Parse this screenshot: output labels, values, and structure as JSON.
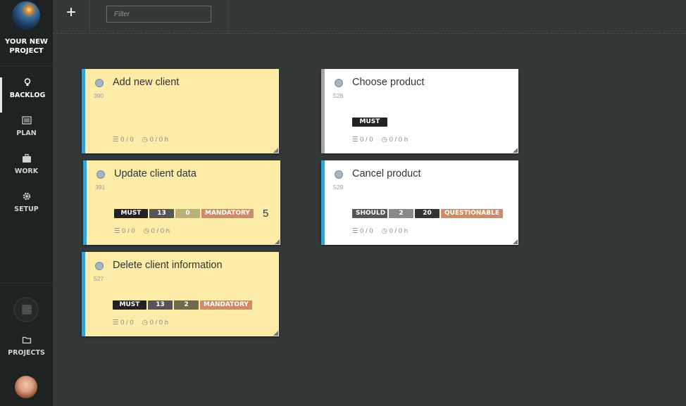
{
  "sidebar": {
    "project_name_line1": "YOUR NEW",
    "project_name_line2": "PROJECT",
    "nav": [
      {
        "label": "BACKLOG",
        "icon": "lightbulb-icon",
        "active": true
      },
      {
        "label": "PLAN",
        "icon": "list-icon",
        "active": false
      },
      {
        "label": "WORK",
        "icon": "briefcase-icon",
        "active": false
      },
      {
        "label": "SETUP",
        "icon": "gear-icon",
        "active": false
      }
    ],
    "projects_label": "PROJECTS"
  },
  "topbar": {
    "add_label": "+",
    "filter_placeholder": "Filter"
  },
  "colors": {
    "accent": "#3aa0d0",
    "card_yellow": "#fdeba8",
    "tag_dark": "#222222",
    "tag_mid": "#555555",
    "tag_light": "#b8b27a",
    "tag_orange": "#d08a65"
  },
  "cards": [
    {
      "title": "Add new client",
      "id": "390",
      "tasks": "0 / 0",
      "time": "0 / 0 h",
      "tags": []
    },
    {
      "title": "Update client data",
      "id": "391",
      "tasks": "0 / 0",
      "time": "0 / 0 h",
      "tags": [
        "MUST",
        "13",
        "0",
        "MANDATORY"
      ],
      "extra": "5"
    },
    {
      "title": "Delete client information",
      "id": "527",
      "tasks": "0 / 0",
      "time": "0 / 0 h",
      "tags": [
        "MUST",
        "13",
        "2",
        "MANDATORY"
      ]
    },
    {
      "title": "Choose product",
      "id": "528",
      "tasks": "0 / 0",
      "time": "0 / 0 h",
      "tags": [
        "MUST"
      ]
    },
    {
      "title": "Cancel product",
      "id": "529",
      "tasks": "0 / 0",
      "time": "0 / 0 h",
      "tags": [
        "SHOULD",
        "2",
        "20",
        "QUESTIONABLE"
      ]
    }
  ]
}
